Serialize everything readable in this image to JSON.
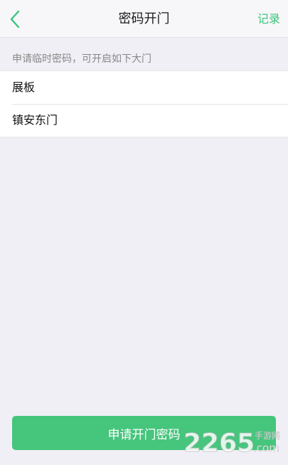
{
  "nav": {
    "title": "密码开门",
    "right_action": "记录",
    "accent_color": "#3cc47c"
  },
  "hint": "申请临时密码，可开启如下大门",
  "doors": [
    {
      "name": "展板"
    },
    {
      "name": "镇安东门"
    }
  ],
  "submit": {
    "label": "申请开门密码",
    "color": "#46c57d"
  },
  "watermark": {
    "number": "2265",
    "suffix": ".com",
    "cn": "手游网"
  }
}
